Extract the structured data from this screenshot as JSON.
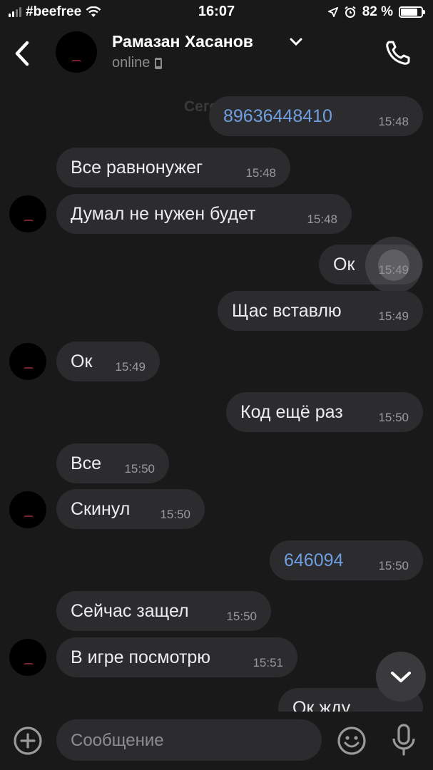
{
  "status_bar": {
    "carrier": "#beefree",
    "time": "16:07",
    "battery_percent": "82 %",
    "battery_level": 0.82,
    "icons": [
      "signal-icon",
      "wifi-icon",
      "location-icon",
      "alarm-icon",
      "battery-icon"
    ]
  },
  "header": {
    "contact_name": "Рамазан Хасанов",
    "status": "online",
    "icons": [
      "back-icon",
      "chevron-down-icon",
      "phone-icon",
      "mobile-device-icon"
    ]
  },
  "chat": {
    "date_label": "Сегодня",
    "messages": [
      {
        "dir": "out",
        "text": "89636448410",
        "time": "15:48",
        "is_link": true
      },
      {
        "dir": "in",
        "text": "Все равнонужег",
        "time": "15:48"
      },
      {
        "dir": "in",
        "text": "Думал не нужен будет",
        "time": "15:48"
      },
      {
        "dir": "out",
        "text": "Ок",
        "time": "15:49"
      },
      {
        "dir": "out",
        "text": "Щас вставлю",
        "time": "15:49"
      },
      {
        "dir": "in",
        "text": "Ок",
        "time": "15:49"
      },
      {
        "dir": "out",
        "text": "Код ещё раз",
        "time": "15:50"
      },
      {
        "dir": "in",
        "text": "Все",
        "time": "15:50"
      },
      {
        "dir": "in",
        "text": "Скинул",
        "time": "15:50"
      },
      {
        "dir": "out",
        "text": "646094",
        "time": "15:50",
        "is_link": true
      },
      {
        "dir": "in",
        "text": "Сейчас защел",
        "time": "15:50"
      },
      {
        "dir": "in",
        "text": "В игре посмотрю",
        "time": "15:51"
      },
      {
        "dir": "out",
        "text": "Ок жду",
        "time": ""
      }
    ]
  },
  "composer": {
    "placeholder": "Сообщение",
    "icons": [
      "plus-icon",
      "smile-icon",
      "mic-icon"
    ]
  },
  "colors": {
    "background": "#19191a",
    "bubble": "#2c2c2e",
    "link": "#6f9ee0",
    "text": "#ececee",
    "time": "#9a9a9d"
  }
}
